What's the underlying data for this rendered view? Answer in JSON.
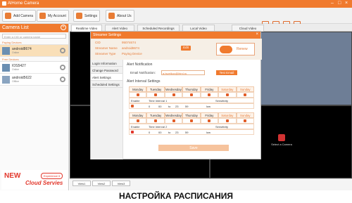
{
  "app": {
    "title": "AlHome Camera"
  },
  "toolbar": {
    "add_camera": "Add Camera",
    "my_account": "My Account",
    "settings": "Settings",
    "about_us": "About Us"
  },
  "camera_list": {
    "title": "Camera List",
    "search_placeholder": "Enter a CID or camera name",
    "groups": [
      {
        "label": "Paying Devices"
      },
      {
        "label": "Free Devices"
      }
    ],
    "devices": [
      {
        "name": "android8674",
        "status": "Online"
      },
      {
        "name": "IOS5427",
        "status": "Online"
      },
      {
        "name": "android5622",
        "status": "Offline"
      }
    ]
  },
  "promo": {
    "new": "NEW",
    "cloud": "Cloud Servies",
    "experience": "Experience it"
  },
  "tabs": [
    "Realtime Video",
    "Alert Video",
    "Scheduled Recordings",
    "Local Video",
    "Cloud Video"
  ],
  "select_camera": "Select a Camera",
  "views": [
    "View1",
    "View2",
    "View3"
  ],
  "caption": "НАСТРОЙКА РАСПИСАНИЯ",
  "dialog": {
    "title": "Streamer Settings",
    "cid_label": "CID",
    "cid_value": "95074674",
    "name_label": "Streamer Name",
    "name_value": "android8674",
    "type_label": "Streamer Type",
    "type_value": "Paying Device",
    "edit": "Edit",
    "renew": "Renew",
    "nav": [
      "Login Information",
      "Change Password",
      "Alert Settings",
      "Scheduled Settings"
    ],
    "alert_notification": "Alert Notification",
    "email_label": "Email Notification:",
    "email_value": "a.tsvetkov@html.ru",
    "test_email": "Test Email",
    "alert_interval": "Alert Interval Settings",
    "days": [
      "Monday",
      "Tuesday",
      "Wednesday",
      "Thursday",
      "Friday",
      "Saturday",
      "Sunday"
    ],
    "enable": "Enable",
    "time_interval_1": "Time Interval 1",
    "time_interval_2": "Time Interval 2",
    "sensitivity": "Sensitivity",
    "t1": {
      "h1": "0",
      "m1": "00",
      "h2": "23",
      "m2": "59"
    },
    "t2": {
      "h1": "0",
      "m1": "00",
      "h2": "23",
      "m2": "59"
    },
    "to": "to",
    "sens_value": "low",
    "save": "Save"
  },
  "colors": {
    "accent": "#f07a2e",
    "light_accent": "#f9dfb8"
  }
}
